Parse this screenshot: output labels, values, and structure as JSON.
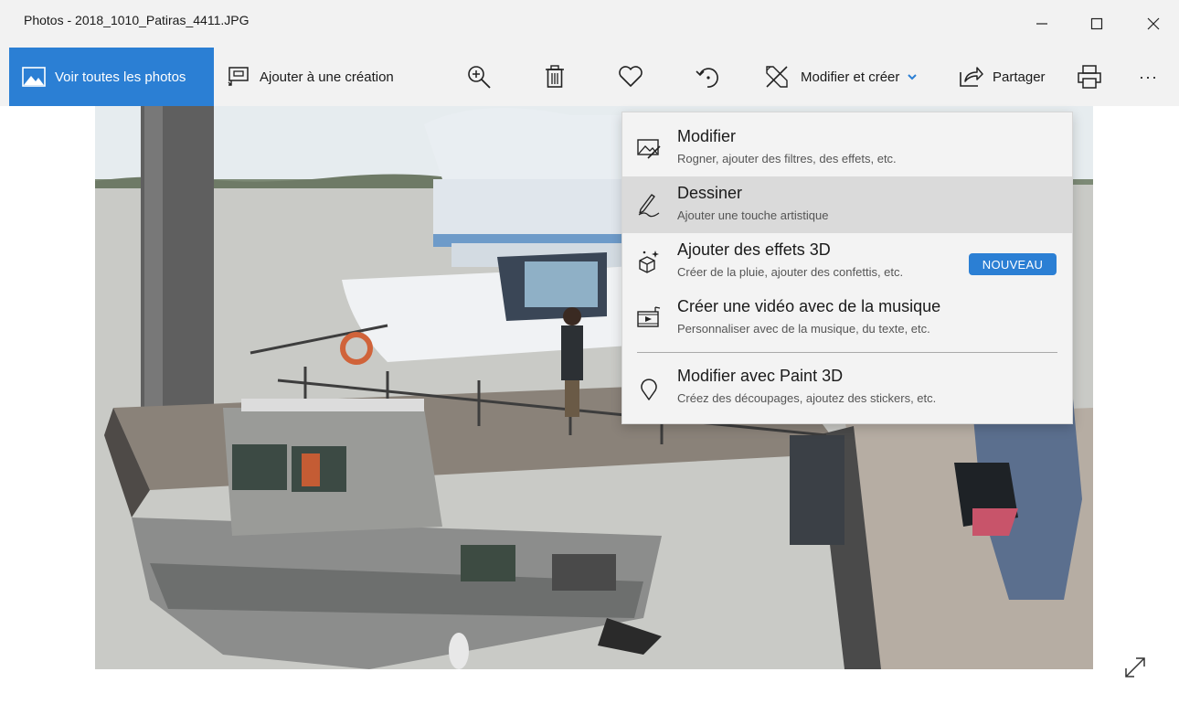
{
  "window": {
    "title": "Photos - 2018_1010_Patiras_4411.JPG",
    "controls": {
      "minimize": "–",
      "maximize": "☐",
      "close": "✕"
    }
  },
  "toolbar": {
    "view_all_label": "Voir toutes les photos",
    "add_to_creation_label": "Ajouter à une création",
    "edit_create_label": "Modifier et créer",
    "share_label": "Partager",
    "more_label": "···",
    "icons": [
      "photo-icon",
      "add-to-creation-icon",
      "zoom-in-icon",
      "delete-icon",
      "heart-icon",
      "rotate-icon",
      "edit-create-icon",
      "chevron-down-icon",
      "share-icon",
      "print-icon",
      "more-icon"
    ],
    "accent": "#2b7fd4"
  },
  "menu": {
    "items": [
      {
        "title": "Modifier",
        "subtitle": "Rogner, ajouter des filtres, des effets, etc.",
        "icon": "edit-image-icon"
      },
      {
        "title": "Dessiner",
        "subtitle": "Ajouter une touche artistique",
        "icon": "draw-pen-icon",
        "highlighted": true
      },
      {
        "title": "Ajouter des effets 3D",
        "subtitle": "Créer de la pluie, ajouter des confettis, etc.",
        "icon": "effects-3d-icon",
        "badge": "NOUVEAU"
      },
      {
        "title": "Créer une vidéo avec de la musique",
        "subtitle": "Personnaliser avec de la musique, du texte, etc.",
        "icon": "video-music-icon"
      },
      {
        "title": "Modifier avec Paint 3D",
        "subtitle": "Créez des découpages, ajoutez des stickers, etc.",
        "icon": "paint-3d-icon"
      }
    ],
    "badge_color": "#2b7fd4",
    "highlight_color": "#dadada"
  },
  "photo": {
    "icon": "photo-content"
  },
  "expand_icon": "expand-icon"
}
